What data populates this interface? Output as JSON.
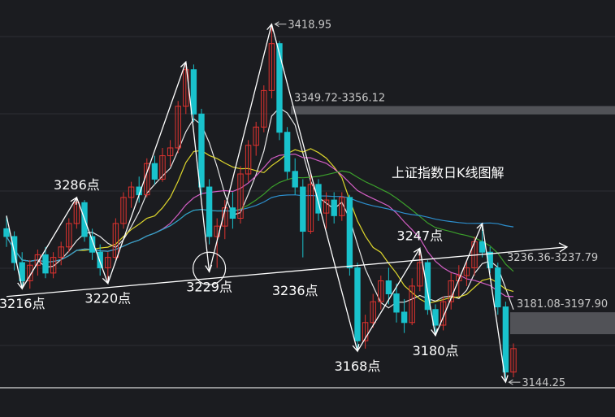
{
  "chart_data": {
    "type": "candlestick",
    "title": "上证指数日K线图解",
    "ylim": [
      3130,
      3430
    ],
    "colors": {
      "background": "#1b1c20",
      "up": "#e0332f",
      "down": "#19c2cc",
      "ma5": "#ffffff",
      "ma10": "#f2ea2e",
      "ma20": "#e866d6",
      "ma30": "#3fae2c",
      "ma60": "#2f9be0",
      "zone": "#5a5c61"
    },
    "candles": [
      {
        "o": 3262,
        "h": 3272,
        "l": 3248,
        "c": 3256
      },
      {
        "o": 3256,
        "h": 3260,
        "l": 3230,
        "c": 3236
      },
      {
        "o": 3236,
        "h": 3244,
        "l": 3218,
        "c": 3222
      },
      {
        "o": 3222,
        "h": 3238,
        "l": 3216,
        "c": 3234
      },
      {
        "o": 3234,
        "h": 3246,
        "l": 3226,
        "c": 3242
      },
      {
        "o": 3242,
        "h": 3248,
        "l": 3224,
        "c": 3228
      },
      {
        "o": 3228,
        "h": 3244,
        "l": 3224,
        "c": 3240
      },
      {
        "o": 3240,
        "h": 3252,
        "l": 3234,
        "c": 3248
      },
      {
        "o": 3248,
        "h": 3270,
        "l": 3244,
        "c": 3266
      },
      {
        "o": 3266,
        "h": 3286,
        "l": 3262,
        "c": 3282
      },
      {
        "o": 3282,
        "h": 3284,
        "l": 3252,
        "c": 3256
      },
      {
        "o": 3256,
        "h": 3262,
        "l": 3238,
        "c": 3244
      },
      {
        "o": 3244,
        "h": 3250,
        "l": 3226,
        "c": 3232
      },
      {
        "o": 3232,
        "h": 3244,
        "l": 3220,
        "c": 3240
      },
      {
        "o": 3240,
        "h": 3270,
        "l": 3238,
        "c": 3266
      },
      {
        "o": 3266,
        "h": 3290,
        "l": 3262,
        "c": 3286
      },
      {
        "o": 3286,
        "h": 3298,
        "l": 3278,
        "c": 3294
      },
      {
        "o": 3294,
        "h": 3302,
        "l": 3282,
        "c": 3288
      },
      {
        "o": 3288,
        "h": 3316,
        "l": 3286,
        "c": 3312
      },
      {
        "o": 3312,
        "h": 3318,
        "l": 3296,
        "c": 3300
      },
      {
        "o": 3300,
        "h": 3324,
        "l": 3298,
        "c": 3318
      },
      {
        "o": 3318,
        "h": 3330,
        "l": 3310,
        "c": 3324
      },
      {
        "o": 3324,
        "h": 3360,
        "l": 3320,
        "c": 3356
      },
      {
        "o": 3356,
        "h": 3390,
        "l": 3350,
        "c": 3384
      },
      {
        "o": 3384,
        "h": 3388,
        "l": 3344,
        "c": 3350
      },
      {
        "o": 3350,
        "h": 3354,
        "l": 3288,
        "c": 3294
      },
      {
        "o": 3294,
        "h": 3300,
        "l": 3250,
        "c": 3256
      },
      {
        "o": 3256,
        "h": 3270,
        "l": 3232,
        "c": 3264
      },
      {
        "o": 3264,
        "h": 3284,
        "l": 3254,
        "c": 3278
      },
      {
        "o": 3278,
        "h": 3290,
        "l": 3262,
        "c": 3270
      },
      {
        "o": 3270,
        "h": 3310,
        "l": 3266,
        "c": 3304
      },
      {
        "o": 3304,
        "h": 3330,
        "l": 3298,
        "c": 3326
      },
      {
        "o": 3326,
        "h": 3344,
        "l": 3318,
        "c": 3340
      },
      {
        "o": 3340,
        "h": 3372,
        "l": 3336,
        "c": 3368
      },
      {
        "o": 3368,
        "h": 3418.95,
        "l": 3362,
        "c": 3404
      },
      {
        "o": 3404,
        "h": 3406,
        "l": 3330,
        "c": 3336
      },
      {
        "o": 3336,
        "h": 3340,
        "l": 3300,
        "c": 3306
      },
      {
        "o": 3306,
        "h": 3316,
        "l": 3288,
        "c": 3294
      },
      {
        "o": 3294,
        "h": 3300,
        "l": 3240,
        "c": 3260
      },
      {
        "o": 3260,
        "h": 3304,
        "l": 3258,
        "c": 3296
      },
      {
        "o": 3296,
        "h": 3300,
        "l": 3268,
        "c": 3274
      },
      {
        "o": 3274,
        "h": 3290,
        "l": 3262,
        "c": 3284
      },
      {
        "o": 3284,
        "h": 3290,
        "l": 3266,
        "c": 3272
      },
      {
        "o": 3272,
        "h": 3290,
        "l": 3268,
        "c": 3286
      },
      {
        "o": 3286,
        "h": 3288,
        "l": 3226,
        "c": 3232
      },
      {
        "o": 3232,
        "h": 3236,
        "l": 3168,
        "c": 3176
      },
      {
        "o": 3176,
        "h": 3196,
        "l": 3170,
        "c": 3190
      },
      {
        "o": 3190,
        "h": 3212,
        "l": 3186,
        "c": 3206
      },
      {
        "o": 3206,
        "h": 3226,
        "l": 3200,
        "c": 3222
      },
      {
        "o": 3222,
        "h": 3232,
        "l": 3204,
        "c": 3212
      },
      {
        "o": 3212,
        "h": 3220,
        "l": 3190,
        "c": 3198
      },
      {
        "o": 3198,
        "h": 3208,
        "l": 3182,
        "c": 3190
      },
      {
        "o": 3190,
        "h": 3224,
        "l": 3188,
        "c": 3218
      },
      {
        "o": 3218,
        "h": 3247,
        "l": 3214,
        "c": 3236
      },
      {
        "o": 3236,
        "h": 3238,
        "l": 3196,
        "c": 3200
      },
      {
        "o": 3200,
        "h": 3204,
        "l": 3180,
        "c": 3188
      },
      {
        "o": 3188,
        "h": 3210,
        "l": 3184,
        "c": 3206
      },
      {
        "o": 3206,
        "h": 3228,
        "l": 3200,
        "c": 3222
      },
      {
        "o": 3222,
        "h": 3234,
        "l": 3210,
        "c": 3226
      },
      {
        "o": 3226,
        "h": 3238,
        "l": 3218,
        "c": 3232
      },
      {
        "o": 3232,
        "h": 3256,
        "l": 3226,
        "c": 3252
      },
      {
        "o": 3252,
        "h": 3266,
        "l": 3240,
        "c": 3244
      },
      {
        "o": 3244,
        "h": 3248,
        "l": 3228,
        "c": 3232
      },
      {
        "o": 3232,
        "h": 3236,
        "l": 3196,
        "c": 3202
      },
      {
        "o": 3202,
        "h": 3206,
        "l": 3144.25,
        "c": 3152
      },
      {
        "o": 3152,
        "h": 3174,
        "l": 3148,
        "c": 3170
      }
    ],
    "moving_averages": [
      {
        "name": "MA5",
        "key": "ma5",
        "period": 5
      },
      {
        "name": "MA10",
        "key": "ma10",
        "period": 10
      },
      {
        "name": "MA20",
        "key": "ma20",
        "period": 20
      },
      {
        "name": "MA30",
        "key": "ma30",
        "period": 30
      },
      {
        "name": "MA60",
        "key": "ma60",
        "period": 60
      }
    ],
    "zones": [
      {
        "label": "3349.72-3356.12",
        "low": 3349.72,
        "high": 3356.12
      },
      {
        "label": "3181.08-3197.90",
        "low": 3181.08,
        "high": 3197.9
      }
    ],
    "price_marks": [
      {
        "label": "3418.95",
        "value": 3418.95,
        "index": 34
      },
      {
        "label": "3144.25",
        "value": 3144.25,
        "index": 64
      }
    ],
    "neckline": {
      "label": "3236.36-3237.79",
      "from": {
        "index": 0,
        "value": 3210
      },
      "to": {
        "index": 68,
        "value": 3248
      }
    },
    "support_value": 3140,
    "zigzag": [
      {
        "index": 0,
        "value": 3272
      },
      {
        "index": 2,
        "value": 3216
      },
      {
        "index": 9,
        "value": 3286
      },
      {
        "index": 13,
        "value": 3220
      },
      {
        "index": 23,
        "value": 3390
      },
      {
        "index": 26,
        "value": 3229
      },
      {
        "index": 34,
        "value": 3418.95
      },
      {
        "index": 45,
        "value": 3168
      },
      {
        "index": 53,
        "value": 3247
      },
      {
        "index": 55,
        "value": 3180
      },
      {
        "index": 61,
        "value": 3266
      },
      {
        "index": 64,
        "value": 3144.25
      }
    ],
    "annotations": [
      {
        "text": "3286点",
        "index": 9,
        "value": 3286,
        "pos": "above"
      },
      {
        "text": "3216点",
        "index": 2,
        "value": 3216,
        "pos": "below"
      },
      {
        "text": "3220点",
        "index": 13,
        "value": 3220,
        "pos": "below"
      },
      {
        "text": "3229点",
        "index": 26,
        "value": 3229,
        "pos": "below"
      },
      {
        "text": "3236点",
        "index": 37,
        "value": 3226,
        "pos": "below"
      },
      {
        "text": "3168点",
        "index": 45,
        "value": 3168,
        "pos": "below"
      },
      {
        "text": "3247点",
        "index": 53,
        "value": 3247,
        "pos": "above"
      },
      {
        "text": "3180点",
        "index": 55,
        "value": 3180,
        "pos": "below"
      }
    ],
    "circle_marker": {
      "index": 26,
      "value": 3229
    }
  }
}
